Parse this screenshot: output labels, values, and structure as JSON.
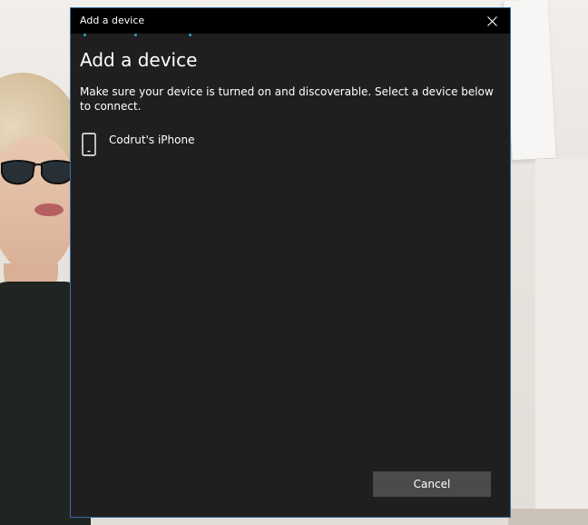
{
  "window": {
    "title": "Add a device",
    "close_icon": "close-icon"
  },
  "main": {
    "heading": "Add a device",
    "instructions": "Make sure your device is turned on and discoverable. Select a device below to connect.",
    "devices": [
      {
        "name": "Codrut's iPhone",
        "icon": "phone-icon"
      }
    ],
    "cancel_label": "Cancel"
  },
  "colors": {
    "dialog_background": "#1f1f1f",
    "titlebar": "#000000",
    "accent": "#2aa7c9",
    "button": "#4b4b4b",
    "window_border": "#3a6fa0"
  }
}
